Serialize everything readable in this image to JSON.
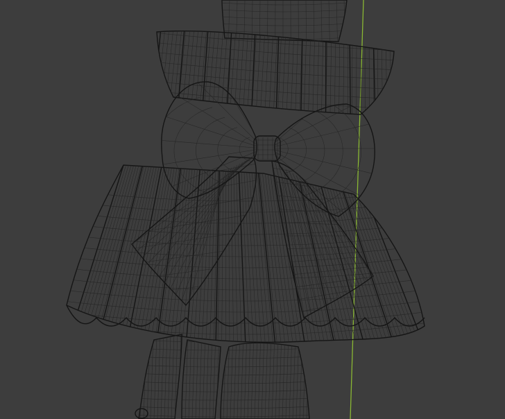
{
  "viewport": {
    "background": "#3d3d3d",
    "mesh_fill": "#bdbdbd",
    "mesh_shade": "#9a9a9a",
    "wire_color": "#1a1a1a",
    "axis_color": "#8ab833"
  },
  "objects": [
    {
      "name": "wrist"
    },
    {
      "name": "ruffled-cuff"
    },
    {
      "name": "bow"
    },
    {
      "name": "bow-ribbon-tails"
    },
    {
      "name": "hand-fingers"
    }
  ]
}
